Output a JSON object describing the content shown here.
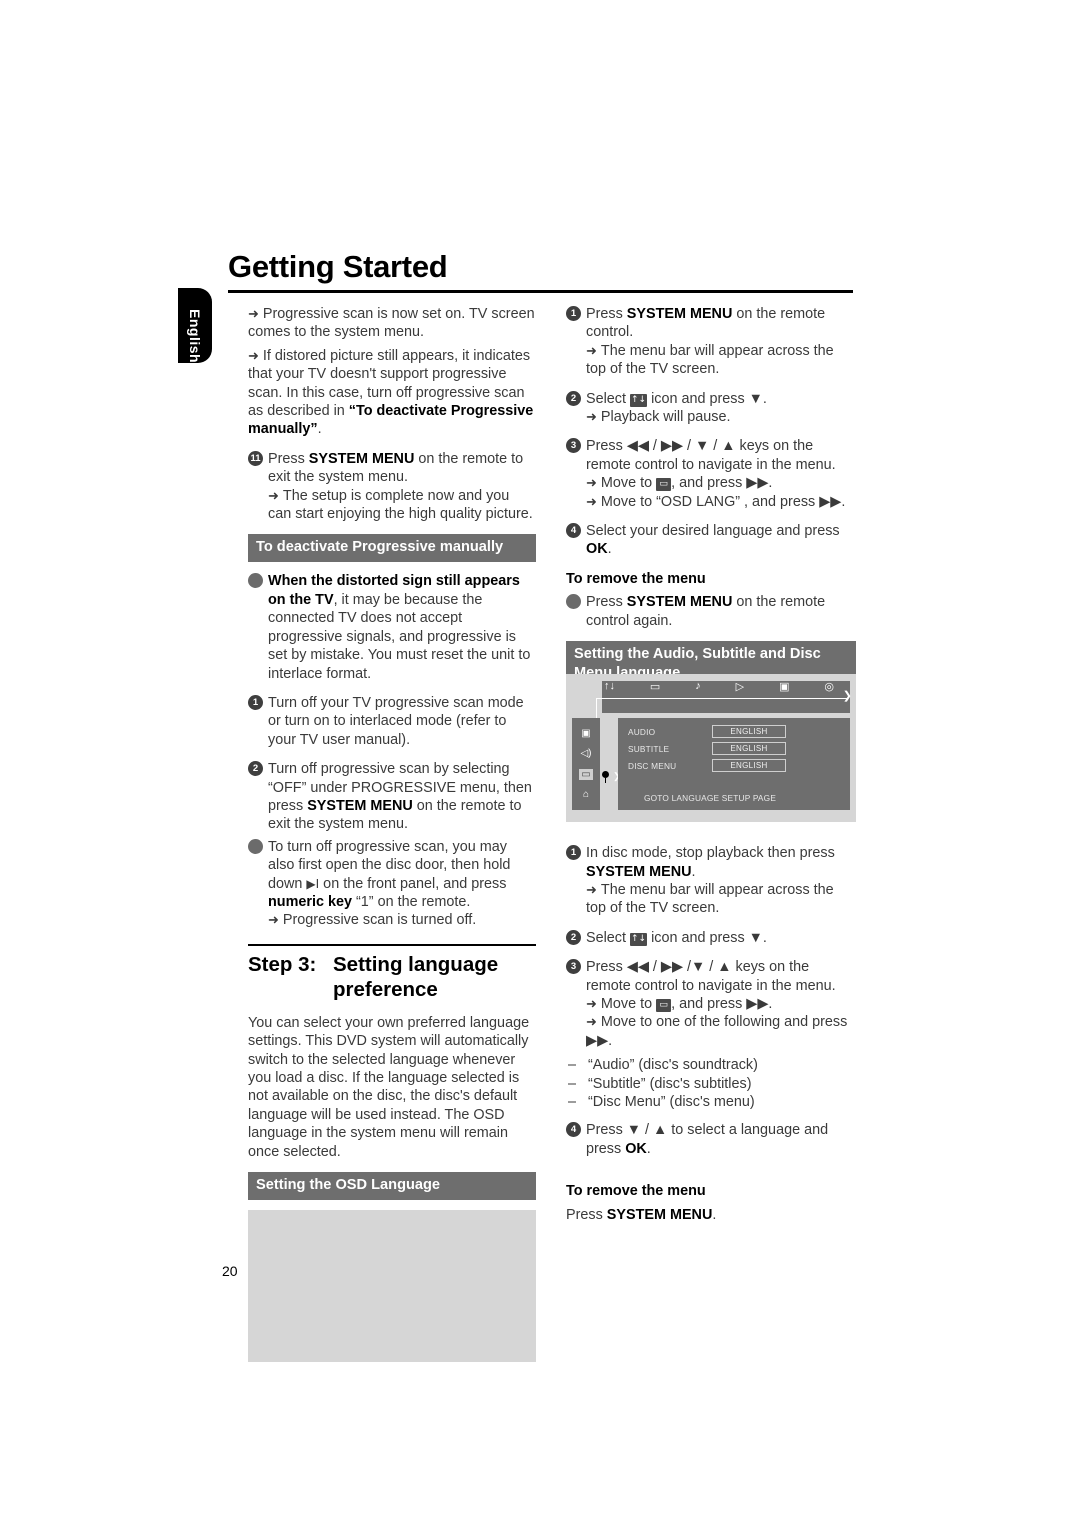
{
  "page": {
    "title": "Getting Started",
    "side_tab": "English",
    "page_number": "20"
  },
  "left_column": {
    "intro_arrows": [
      "Progressive scan is now set on. TV screen comes to the system menu.",
      "If distored picture still appears, it indicates that your TV doesn't support progressive scan. In this case, turn off progressive scan as described in "
    ],
    "intro_arrow2_bold": "“To deactivate Progressive manually”",
    "intro_arrow2_tail": ".",
    "step11": {
      "marker": "11",
      "text_pre": "Press ",
      "text_bold": "SYSTEM MENU",
      "text_post": " on the remote to exit the system menu.",
      "arrow": "The setup is complete now and you can start enjoying the high quality picture."
    },
    "deactivate_header": "To deactivate Progressive manually",
    "deactivate_bullet": {
      "bold": "When the distorted sign still appears on the TV",
      "rest": ", it may be because the connected TV does not accept progressive signals, and progressive is set by mistake. You must reset the unit to interlace format."
    },
    "deactivate_steps": [
      {
        "marker": "1",
        "text": "Turn off your TV progressive scan mode or turn on to interlaced mode (refer to your TV user manual)."
      },
      {
        "marker": "2",
        "text_pre": "Turn off progressive scan by selecting “OFF” under PROGRESSIVE menu, then press ",
        "text_bold": "SYSTEM MENU",
        "text_post": " on the remote to exit the system menu."
      }
    ],
    "deactivate_last_bullet": {
      "pre": "To turn off progressive scan, you may also first open the disc door, then hold down ",
      "glyph": "▶I",
      "mid": " on the front panel, and press ",
      "bold": "numeric key",
      "post": " “1” on the remote.",
      "arrow": "Progressive scan is turned off."
    },
    "step3": {
      "label": "Step 3:",
      "heading": "Setting language preference",
      "body": "You can select your own preferred language settings. This DVD system will automatically switch to the selected language whenever you load a disc. If the language selected is not available on the disc, the disc's default language will be used instead. The OSD language in the system menu will remain once selected."
    },
    "osd_header": "Setting the OSD Language"
  },
  "right_column": {
    "osd_steps": [
      {
        "marker": "1",
        "text_pre": "Press ",
        "text_bold": "SYSTEM MENU",
        "text_post": " on the remote control.",
        "arrows": [
          "The menu bar will appear across the top of the TV screen."
        ]
      },
      {
        "marker": "2",
        "text_pre": "Select ",
        "icon": "preference-icon",
        "icon_glyph": "↑↓",
        "text_post": " icon and press ▼.",
        "arrows": [
          "Playback will pause."
        ]
      },
      {
        "marker": "3",
        "text_pre": "Press ◀◀ / ▶▶ / ▼ / ▲ keys on the remote control to navigate in the menu.",
        "arrows_rich": [
          {
            "pre": "Move to ",
            "icon_glyph": "▭",
            "post": ", and press ▶▶."
          },
          {
            "pre": "Move to “OSD LANG” , and press ▶▶.",
            "icon_glyph": "",
            "post": ""
          }
        ]
      },
      {
        "marker": "4",
        "text_pre": "Select your desired language and press ",
        "text_bold": "OK",
        "text_post": "."
      }
    ],
    "remove_menu_1": {
      "heading": "To remove the menu",
      "pre": "Press ",
      "bold": "SYSTEM MENU",
      "post": " on the remote control again."
    },
    "audio_header": "Setting the Audio, Subtitle and Disc Menu language",
    "audio_steps": [
      {
        "marker": "1",
        "text_pre": "In disc mode, stop playback then press ",
        "text_bold": "SYSTEM MENU",
        "text_post": ".",
        "arrows": [
          "The menu bar will appear across the top of the TV screen."
        ]
      },
      {
        "marker": "2",
        "text_pre": "Select ",
        "icon_glyph": "↑↓",
        "text_post": " icon and press ▼."
      },
      {
        "marker": "3",
        "text_pre": "Press ◀◀ / ▶▶ /▼ / ▲ keys on the remote control to navigate in the menu.",
        "arrows_rich": [
          {
            "pre": "Move to ",
            "icon_glyph": "▭",
            "post": ", and press ▶▶."
          },
          {
            "pre": "Move to one of the following and press ▶▶.",
            "icon_glyph": "",
            "post": ""
          }
        ]
      }
    ],
    "dash_items": [
      "“Audio” (disc's soundtrack)",
      "“Subtitle” (disc's subtitles)",
      "“Disc Menu” (disc's menu)"
    ],
    "step4": {
      "marker": "4",
      "text_pre": "Press ▼ / ▲ to select a language and press ",
      "text_bold": "OK",
      "text_post": "."
    },
    "remove_menu_2": {
      "heading": "To remove the menu",
      "pre": "Press ",
      "bold": "SYSTEM MENU",
      "post": "."
    }
  },
  "tv_osd": {
    "menubar_icons": [
      "↑↓",
      "▭",
      "♪",
      "▷",
      "▣",
      "◎"
    ],
    "menubar_arrow": "❯",
    "sidebar_icons": [
      "▣",
      "◁)",
      "▭",
      "⌂"
    ],
    "rows": [
      {
        "label": "AUDIO",
        "value": "ENGLISH"
      },
      {
        "label": "SUBTITLE",
        "value": "ENGLISH"
      },
      {
        "label": "DISC MENU",
        "value": "ENGLISH"
      }
    ],
    "footer": "GOTO LANGUAGE SETUP PAGE"
  },
  "colors": {
    "header_bar": "#6e6e6e",
    "placeholder": "#d6d6d6",
    "text": "#3a3a3a",
    "tab": "#000000"
  }
}
